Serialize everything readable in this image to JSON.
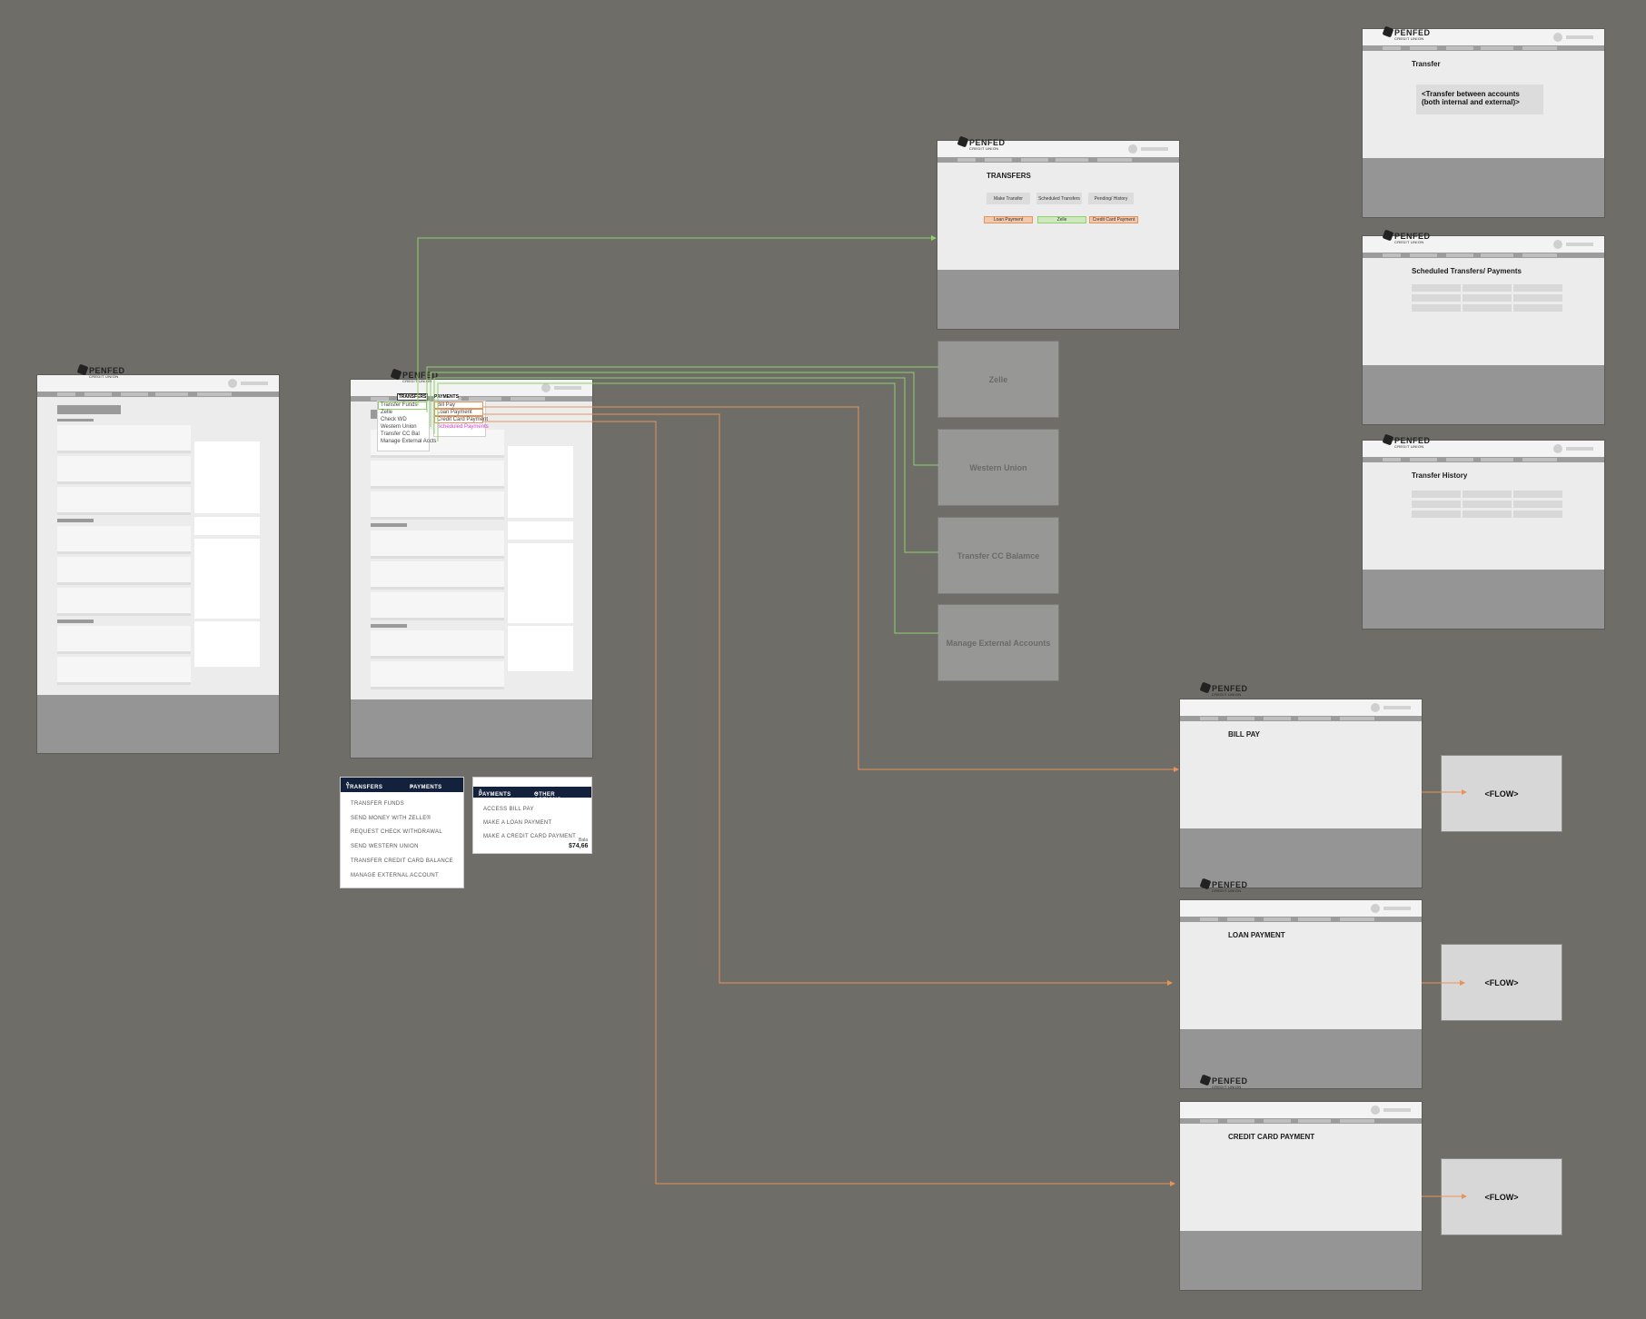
{
  "brand": {
    "logo_main": "PENFED",
    "logo_sub": "CREDIT UNION"
  },
  "transfer_menu": {
    "tab_transfers": "TRANSFERS",
    "tab_payments": "PAYMENTS",
    "transfers_items": [
      "Transfer Funds",
      "Zelle",
      "Check WD",
      "Western Union",
      "Transfer CC Bal",
      "Manage External Accts"
    ],
    "payments_items": [
      "Bill Pay",
      "Loan Payment",
      "Credit Card Payment",
      "Scheduled Payments"
    ]
  },
  "dropdown_transfers": {
    "tab_transfers": "TRANSFERS",
    "tab_payments": "PAYMENTS",
    "items": [
      "TRANSFER FUNDS",
      "SEND MONEY WITH ZELLE®",
      "REQUEST CHECK WITHDRAWAL",
      "SEND WESTERN UNION",
      "TRANSFER CREDIT CARD BALANCE",
      "MANAGE EXTERNAL ACCOUNT"
    ]
  },
  "dropdown_payments": {
    "tab_payments": "PAYMENTS",
    "tab_other": "OTHER ACTIONS",
    "items": [
      "ACCESS BILL PAY",
      "MAKE A LOAN PAYMENT",
      "MAKE A CREDIT CARD PAYMENT"
    ],
    "balance_label": "Bala",
    "balance_value": "$74,66"
  },
  "transfers_page": {
    "title": "TRANSFERS",
    "buttons": [
      "Make Transfer",
      "Scheduled Transfers",
      "Pending/ History"
    ],
    "pills": [
      "Loan Payment",
      "Zelle",
      "Credit Card Payment"
    ]
  },
  "destinations": [
    "Zelle",
    "Western Union",
    "Transfer CC Balamce",
    "Manage External Accounts"
  ],
  "right_pages": {
    "transfer": {
      "title": "Transfer",
      "note": "<Transfer between accounts (both internal and external)>"
    },
    "scheduled": {
      "title": "Scheduled Transfers/ Payments"
    },
    "history": {
      "title": "Transfer History"
    }
  },
  "payment_pages": {
    "bill_pay": "BILL PAY",
    "loan_payment": "LOAN PAYMENT",
    "credit_card_payment": "CREDIT CARD PAYMENT",
    "flow_label": "<FLOW>"
  },
  "colors": {
    "background": "#6e6d68",
    "green_link": "#8fd16a",
    "orange_link": "#e8935a",
    "magenta": "#d33ad3",
    "nav_dark": "#14213d"
  }
}
